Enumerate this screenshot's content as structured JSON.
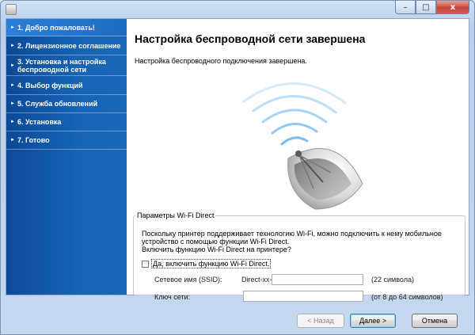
{
  "window": {
    "controls": {
      "minimize": "–",
      "maximize": "□",
      "close": "x"
    }
  },
  "sidebar": {
    "steps": [
      {
        "label": "1. Добро пожаловать!",
        "active": true
      },
      {
        "label": "2. Лицензионное соглашение",
        "active": false
      },
      {
        "label": "3. Установка и настройка беспроводной сети",
        "active": false
      },
      {
        "label": "4. Выбор функций",
        "active": false
      },
      {
        "label": "5. Служба обновлений",
        "active": false
      },
      {
        "label": "6. Установка",
        "active": false
      },
      {
        "label": "7. Готово",
        "active": false
      }
    ],
    "bullet": "►"
  },
  "main": {
    "title": "Настройка беспроводной сети завершена",
    "subtitle": "Настройка беспроводного подключения завершена.",
    "illustration_icon": "wireless-satellite-dish-icon"
  },
  "wifi_direct": {
    "legend": "Параметры Wi-Fi Direct",
    "description_line1": "Поскольку принтер поддерживает технологию Wi-Fi, можно подключить к нему мобильное",
    "description_line2": "устройство с помощью функции Wi-Fi Direct.",
    "description_line3": "Включить функцию Wi-Fi Direct на принтере?",
    "enable_checkbox_label": "Да, включить функцию Wi-Fi Direct.",
    "enable_checked": false,
    "ssid_label": "Сетевое имя (SSID):",
    "ssid_prefix": "Direct-xx-",
    "ssid_value": "",
    "ssid_hint": "(22 символа)",
    "key_label": "Ключ сети:",
    "key_value": "",
    "key_hint": "(от 8 до 64 символов)"
  },
  "footer": {
    "back_label": "< Назад",
    "next_label": "Далее >",
    "cancel_label": "Отмена"
  },
  "colors": {
    "sidebar_blue": "#1763b6",
    "title_bar": "#c4d8ef",
    "close_red": "#c9473b"
  }
}
